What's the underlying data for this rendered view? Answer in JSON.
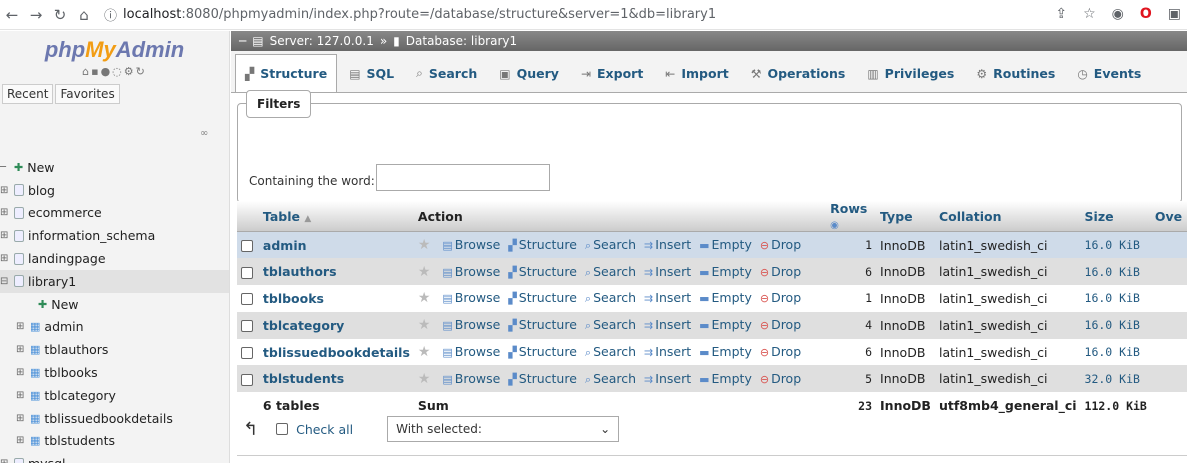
{
  "browser": {
    "url_host": "localhost",
    "url_rest": ":8080/phpmyadmin/index.php?route=/database/structure&server=1&db=library1"
  },
  "sidebar": {
    "logo_php": "php",
    "logo_my": "My",
    "logo_admin": "Admin",
    "recent": "Recent",
    "favorites": "Favorites",
    "tree": [
      {
        "label": "New",
        "type": "new",
        "level": 0
      },
      {
        "label": "blog",
        "type": "db",
        "level": 0
      },
      {
        "label": "ecommerce",
        "type": "db",
        "level": 0
      },
      {
        "label": "information_schema",
        "type": "db",
        "level": 0
      },
      {
        "label": "landingpage",
        "type": "db",
        "level": 0
      },
      {
        "label": "library1",
        "type": "db",
        "level": 0
      },
      {
        "label": "New",
        "type": "new",
        "level": 2
      },
      {
        "label": "admin",
        "type": "table",
        "level": 1
      },
      {
        "label": "tblauthors",
        "type": "table",
        "level": 1
      },
      {
        "label": "tblbooks",
        "type": "table",
        "level": 1
      },
      {
        "label": "tblcategory",
        "type": "table",
        "level": 1
      },
      {
        "label": "tblissuedbookdetails",
        "type": "table",
        "level": 1
      },
      {
        "label": "tblstudents",
        "type": "table",
        "level": 1
      },
      {
        "label": "mysql",
        "type": "db",
        "level": 0
      }
    ]
  },
  "breadcrumb": {
    "server": "Server: 127.0.0.1",
    "sep": "»",
    "database": "Database: library1"
  },
  "tabs": [
    "Structure",
    "SQL",
    "Search",
    "Query",
    "Export",
    "Import",
    "Operations",
    "Privileges",
    "Routines",
    "Events"
  ],
  "filters": {
    "legend": "Filters",
    "label": "Containing the word:",
    "value": ""
  },
  "table": {
    "headers": {
      "table": "Table",
      "action": "Action",
      "rows": "Rows",
      "type": "Type",
      "collation": "Collation",
      "size": "Size",
      "overhead": "Ove"
    },
    "actions": [
      "Browse",
      "Structure",
      "Search",
      "Insert",
      "Empty",
      "Drop"
    ],
    "rows": [
      {
        "name": "admin",
        "rows": "1",
        "type": "InnoDB",
        "collation": "latin1_swedish_ci",
        "size": "16.0 KiB"
      },
      {
        "name": "tblauthors",
        "rows": "6",
        "type": "InnoDB",
        "collation": "latin1_swedish_ci",
        "size": "16.0 KiB"
      },
      {
        "name": "tblbooks",
        "rows": "1",
        "type": "InnoDB",
        "collation": "latin1_swedish_ci",
        "size": "16.0 KiB"
      },
      {
        "name": "tblcategory",
        "rows": "4",
        "type": "InnoDB",
        "collation": "latin1_swedish_ci",
        "size": "16.0 KiB"
      },
      {
        "name": "tblissuedbookdetails",
        "rows": "6",
        "type": "InnoDB",
        "collation": "latin1_swedish_ci",
        "size": "16.0 KiB"
      },
      {
        "name": "tblstudents",
        "rows": "5",
        "type": "InnoDB",
        "collation": "latin1_swedish_ci",
        "size": "32.0 KiB"
      }
    ],
    "sum": {
      "name": "6 tables",
      "label": "Sum",
      "rows": "23",
      "type": "InnoDB",
      "collation": "utf8mb4_general_ci",
      "size": "112.0 KiB"
    }
  },
  "bottom": {
    "check_all": "Check all",
    "with_selected": "With selected:"
  }
}
